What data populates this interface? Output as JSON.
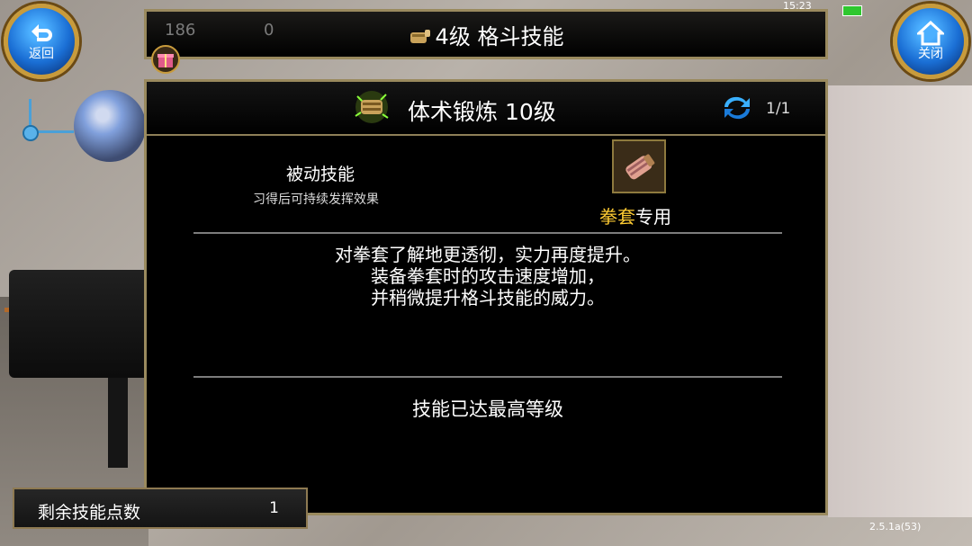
{
  "status_bar": {
    "time": "15:23"
  },
  "hud": {
    "stat_left": "186",
    "stat_mid": "0"
  },
  "header": {
    "title": "4级 格斗技能"
  },
  "nav": {
    "back_label": "返回",
    "close_label": "关闭"
  },
  "skill": {
    "name": "体术锻炼 10级",
    "page": "1/1",
    "type": "被动技能",
    "type_desc": "习得后可持续发挥效果",
    "weapon_name": "拳套",
    "weapon_suffix": "专用",
    "description": [
      "对拳套了解地更透彻，实力再度提升。",
      "装备拳套时的攻击速度增加，",
      "并稍微提升格斗技能的威力。"
    ],
    "status": "技能已达最高等级"
  },
  "skill_points": {
    "label": "剩余技能点数",
    "value": "1"
  },
  "version": "2.5.1a(53)",
  "colors": {
    "accent_gold": "#9a8a5e",
    "weapon_highlight": "#ffcc33",
    "button_blue": "#1a6ed4"
  }
}
